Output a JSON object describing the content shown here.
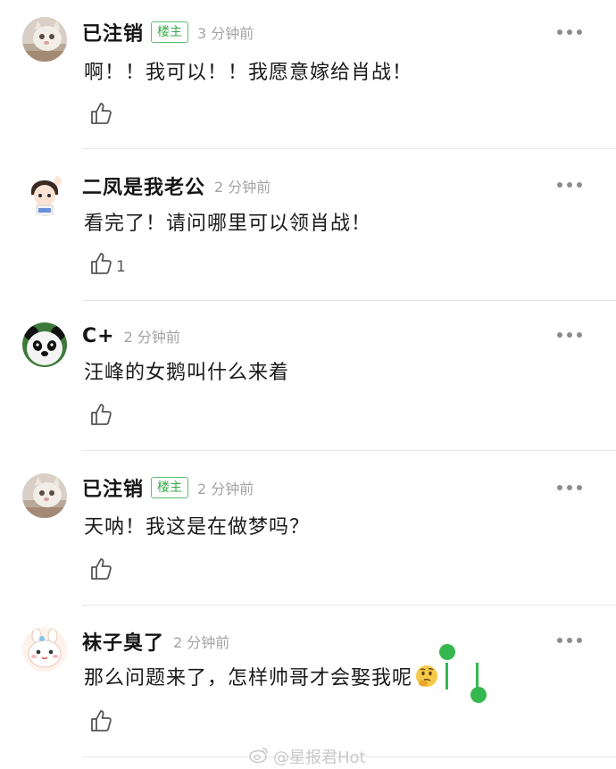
{
  "comments": [
    {
      "username": "已注销",
      "badge": "楼主",
      "time": "3 分钟前",
      "content": "啊！！我可以！！我愿意嫁给肖战！",
      "likes": "",
      "avatar": "cat-avatar"
    },
    {
      "username": "二凤是我老公",
      "badge": "",
      "time": "2 分钟前",
      "content": "看完了！请问哪里可以领肖战！",
      "likes": "1",
      "avatar": "cartoon-boy-avatar"
    },
    {
      "username": "C+",
      "badge": "",
      "time": "2 分钟前",
      "content": "汪峰的女鹅叫什么来着",
      "likes": "",
      "avatar": "panda-avatar"
    },
    {
      "username": "已注销",
      "badge": "楼主",
      "time": "2 分钟前",
      "content": "天呐！我这是在做梦吗？",
      "likes": "",
      "avatar": "cat-avatar"
    },
    {
      "username": "袜子臭了",
      "badge": "",
      "time": "2 分钟前",
      "content": "那么问题来了，怎样帅哥才会娶我呢",
      "likes": "",
      "avatar": "cartoon-rabbit-avatar",
      "emoji": "thinking-face-emoji"
    }
  ],
  "watermark": {
    "text": "@星报君Hot",
    "icon": "weibo-icon"
  },
  "colors": {
    "badge_green": "#38a84b",
    "selection_green": "#35b84f",
    "time_gray": "#a3a3a3"
  }
}
